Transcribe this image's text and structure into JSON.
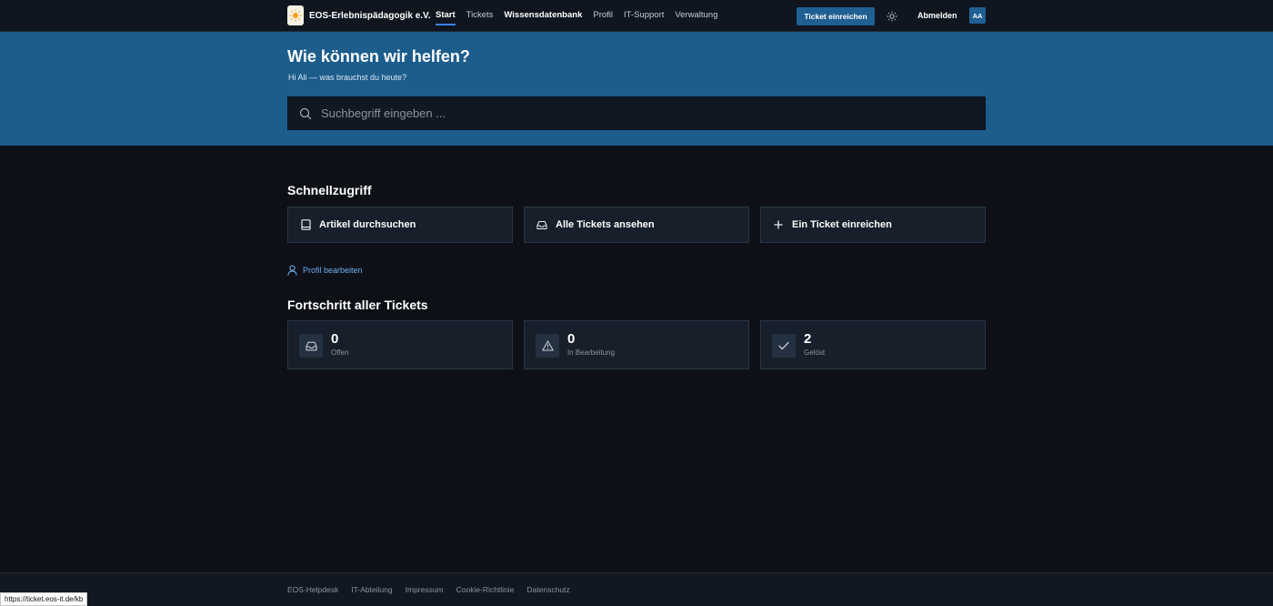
{
  "brand": {
    "name": "EOS-Erlebnispädagogik e.V.",
    "logo_icon": "sun-logo-icon"
  },
  "nav": {
    "links": [
      {
        "label": "Start",
        "active": true
      },
      {
        "label": "Tickets",
        "active": false
      },
      {
        "label": "Wissensdatenbank",
        "active": false
      },
      {
        "label": "Profil",
        "active": false
      },
      {
        "label": "IT-Support",
        "active": false
      },
      {
        "label": "Verwaltung",
        "active": false
      }
    ],
    "cta_label": "Ticket einreichen",
    "theme_icon": "sun-icon",
    "logout_label": "Abmelden",
    "avatar_initials": "AA"
  },
  "hero": {
    "title": "Wie können wir helfen?",
    "subtitle": "Hi Ali — was brauchst du heute?",
    "search_placeholder": "Suchbegriff eingeben ..."
  },
  "quick_access": {
    "title": "Schnellzugriff",
    "cards": [
      {
        "label": "Artikel durchsuchen",
        "icon": "book-icon"
      },
      {
        "label": "Alle Tickets ansehen",
        "icon": "inbox-icon"
      },
      {
        "label": "Ein Ticket einreichen",
        "icon": "plus-icon"
      }
    ],
    "profile_link": "Profil bearbeiten"
  },
  "progress": {
    "title": "Fortschritt aller Tickets",
    "stats": [
      {
        "value": "0",
        "label": "Offen",
        "icon": "inbox-icon"
      },
      {
        "value": "0",
        "label": "In Bearbeitung",
        "icon": "warning-icon"
      },
      {
        "value": "2",
        "label": "Gelöst",
        "icon": "check-icon"
      }
    ]
  },
  "footer": {
    "links": [
      "EOS-Helpdesk",
      "IT-Abteilung",
      "Impressum",
      "Cookie-Richtlinie",
      "Datenschutz"
    ]
  },
  "status_bar": {
    "url": "https://ticket.eos-it.de/kb"
  },
  "colors": {
    "accent": "#1f5f92",
    "hero_bg": "#1c5d8c",
    "page_bg": "#0d1117",
    "card_bg": "#161f2a",
    "link": "#6cb0f0"
  }
}
